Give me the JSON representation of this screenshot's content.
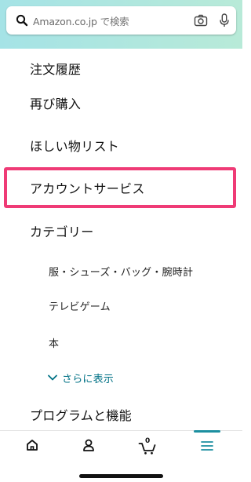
{
  "search": {
    "placeholder_brand": "Amazon.co.jp",
    "placeholder_suffix": "で検索",
    "search_icon": "search-icon",
    "camera_icon": "camera-icon",
    "mic_icon": "microphone-icon"
  },
  "menu": {
    "orders": "注文履歴",
    "buy_again": "再び購入",
    "wishlist": "ほしい物リスト",
    "account_services": "アカウントサービス",
    "categories": "カテゴリー",
    "category_items": [
      "服・シューズ・バッグ・腕時計",
      "テレビゲーム",
      "本"
    ],
    "show_more": "さらに表示",
    "programs": "プログラムと機能"
  },
  "tabbar": {
    "home_icon": "home-icon",
    "account_icon": "account-icon",
    "cart_icon": "cart-icon",
    "cart_count": "0",
    "menu_icon": "hamburger-menu-icon",
    "active_tab": "menu"
  },
  "colors": {
    "highlight": "#ef3b76",
    "accent": "#1c8fa0",
    "link": "#007185"
  }
}
